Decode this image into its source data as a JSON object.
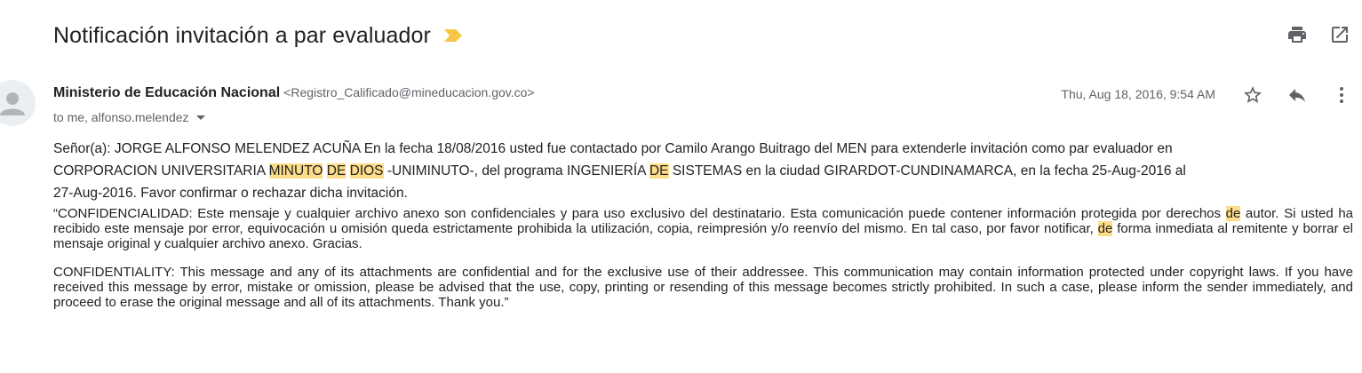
{
  "subject": "Notificación invitación a par evaluador",
  "icons": {
    "important": "important-marker-icon",
    "print": "print-icon",
    "open_new_window": "open-in-new-window-icon",
    "avatar": "person-avatar-icon",
    "star": "star-icon",
    "reply": "reply-icon",
    "more": "more-vert-icon",
    "expand_recipients": "caret-down-icon"
  },
  "colors": {
    "highlight": "#fddc8a",
    "important_marker": "#f6c644"
  },
  "message": {
    "sender_name": "Ministerio de Educación Nacional",
    "sender_email": "<Registro_Calificado@mineducacion.gov.co>",
    "recipients": "to me, alfonso.melendez",
    "date": "Thu, Aug 18, 2016, 9:54 AM"
  },
  "body": {
    "intro_line1": "Señor(a): JORGE ALFONSO MELENDEZ ACUÑA En la fecha 18/08/2016 usted fue contactado por Camilo Arango Buitrago del MEN para extenderle invitación como par evaluador en",
    "line2_a": "CORPORACION UNIVERSITARIA ",
    "hl_minuto": "MINUTO",
    "hl_de1": "DE",
    "hl_dios": "DIOS",
    "line2_b": " -UNIMINUTO-, del programa INGENIERÍA ",
    "hl_de2": "DE",
    "line2_c": " SISTEMAS en la ciudad GIRARDOT-CUNDINAMARCA, en la fecha 25-Aug-2016 al",
    "intro_line3": "27-Aug-2016. Favor confirmar o rechazar dicha invitación.",
    "conf_es_a": "“CONFIDENCIALIDAD: Este mensaje y cualquier archivo anexo son confidenciales y para uso exclusivo del destinatario. Esta comunicación puede contener información protegida por derechos ",
    "hl_de3": "de",
    "conf_es_b": " autor. Si usted ha recibido este mensaje por error, equivocación u omisión queda estrictamente prohibida la utilización, copia, reimpresión y/o reenvío del mismo. En tal caso, por favor notificar, ",
    "hl_de4": "de",
    "conf_es_c": " forma inmediata al remitente y borrar el mensaje original y cualquier archivo anexo. Gracias.",
    "conf_en": "CONFIDENTIALITY: This message and any of its attachments are confidential and for the exclusive use of their addressee. This communication may contain information protected under copyright laws. If you have received this message by error, mistake or omission, please be advised that the use, copy, printing or resending of this message becomes strictly prohibited. In such a case, please inform the sender immediately, and proceed to erase the original message and all of its attachments. Thank you.”"
  }
}
